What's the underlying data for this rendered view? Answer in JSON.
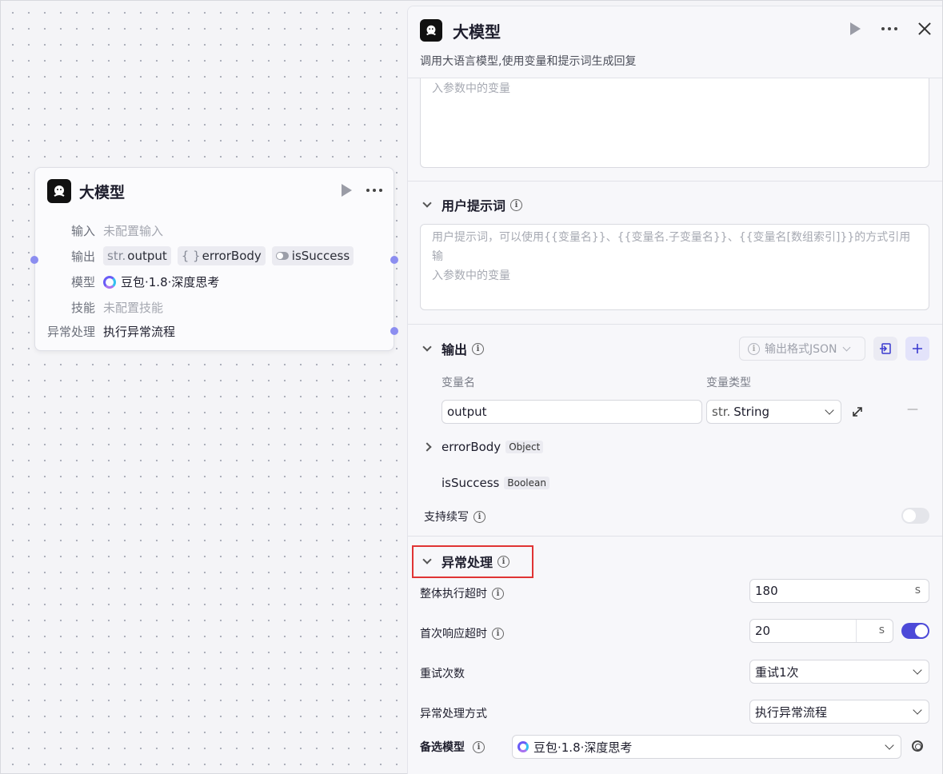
{
  "node": {
    "title": "大模型",
    "rows": {
      "input_label": "输入",
      "input_value": "未配置输入",
      "output_label": "输出",
      "outputs": [
        {
          "prefix": "str.",
          "name": "output"
        },
        {
          "prefix": "{ }",
          "name": "errorBody"
        },
        {
          "prefix": "",
          "name": "isSuccess"
        }
      ],
      "model_label": "模型",
      "model_value": "豆包·1.8·深度思考",
      "skill_label": "技能",
      "skill_value": "未配置技能",
      "error_label": "异常处理",
      "error_value": "执行异常流程"
    }
  },
  "panel": {
    "title": "大模型",
    "description": "调用大语言模型,使用变量和提示词生成回复",
    "system_prompt_tail": "入参数中的变量",
    "user_prompt": {
      "label": "用户提示词",
      "placeholder_line1": "用户提示词，可以使用{{变量名}}、{{变量名.子变量名}}、{{变量名[数组索引]}}的方式引用输",
      "placeholder_line2": "入参数中的变量"
    },
    "output": {
      "label": "输出",
      "format_label": "输出格式JSON",
      "col_name": "变量名",
      "col_type": "变量类型",
      "var_name": "output",
      "var_type_prefix": "str.",
      "var_type": "String",
      "minus": "—",
      "error_body": "errorBody",
      "error_body_type": "Object",
      "is_success": "isSuccess",
      "is_success_type": "Boolean",
      "continue_label": "支持续写"
    },
    "exception": {
      "label": "异常处理",
      "timeout_label": "整体执行超时",
      "timeout_value": "180",
      "timeout_unit": "s",
      "first_label": "首次响应超时",
      "first_value": "20",
      "first_unit": "s",
      "retry_label": "重试次数",
      "retry_value": "重试1次",
      "method_label": "异常处理方式",
      "method_value": "执行异常流程",
      "backup_label": "备选模型",
      "backup_value": "豆包·1.8·深度思考"
    }
  }
}
